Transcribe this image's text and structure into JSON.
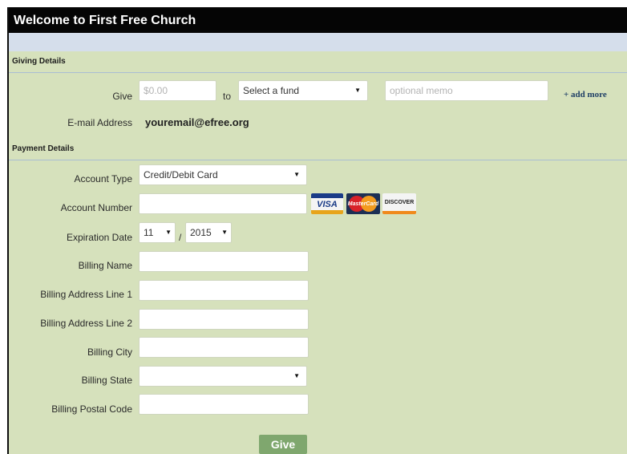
{
  "page": {
    "title": "Welcome to First Free Church"
  },
  "giving": {
    "header": "Giving Details",
    "give_label": "Give",
    "amount_placeholder": "$0.00",
    "to_label": "to",
    "fund_select": "Select a fund",
    "memo_placeholder": "optional memo",
    "add_more": "+ add more",
    "email_label": "E-mail Address",
    "email_value": "youremail@efree.org"
  },
  "payment": {
    "header": "Payment Details",
    "account_type_label": "Account Type",
    "account_type_value": "Credit/Debit Card",
    "account_number_label": "Account Number",
    "account_number_value": "",
    "cards": {
      "visa": "VISA",
      "mastercard": "MasterCard",
      "discover": "DISCOVER"
    },
    "expiration_label": "Expiration Date",
    "exp_month": "11",
    "exp_separator": "/",
    "exp_year": "2015",
    "billing_name_label": "Billing Name",
    "billing_address1_label": "Billing Address Line 1",
    "billing_address2_label": "Billing Address Line 2",
    "billing_city_label": "Billing City",
    "billing_state_label": "Billing State",
    "billing_state_value": "",
    "billing_postal_label": "Billing Postal Code"
  },
  "actions": {
    "give_button": "Give"
  },
  "icons": {
    "caret": "caret-down-icon"
  }
}
